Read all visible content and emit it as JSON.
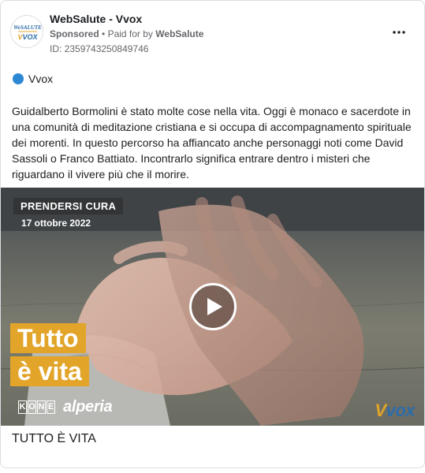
{
  "advertiser": {
    "name": "WebSalute - Vvox",
    "sponsored_label": "Sponsored",
    "paid_for_prefix": "Paid for by",
    "paid_for_by": "WebSalute",
    "ad_id": "ID: 2359743250849746",
    "avatar_text_top": "WebSalute",
    "avatar_text_bottom": "Vvox"
  },
  "platform": {
    "label": "Vvox",
    "color": "#2d88d4"
  },
  "body": {
    "text": "Guidalberto Bormolini è stato molte cose nella vita. Oggi è monaco e sacerdote in una comunità di meditazione cristiana e si occupa di accompagnamento spirituale dei morenti. In questo percorso ha affiancato anche personaggi noti come David Sassoli o Franco Battiato. Incontrarlo significa entrare dentro i misteri che riguardano il vivere più che il morire."
  },
  "media": {
    "category": "PRENDERSI CURA",
    "date": "17 ottobre 2022",
    "title_line1": "Tutto",
    "title_line2": "è vita",
    "sponsor_kone": [
      "K",
      "O",
      "N",
      "E"
    ],
    "sponsor_alperia": "alperia",
    "brand_v": "V",
    "brand_rest": "vox",
    "accent_color": "#e2a52a",
    "brand_blue": "#2d6ca8"
  },
  "headline": "TUTTO È VITA"
}
